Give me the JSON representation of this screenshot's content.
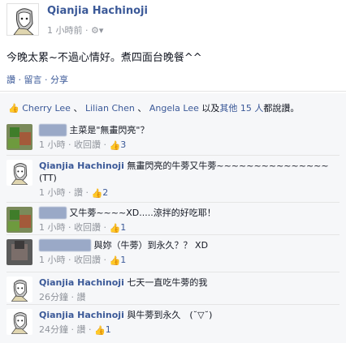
{
  "post": {
    "author": "Qianjia Hachinoji",
    "time": "1 小時前 · ",
    "text": "今晚太累~不過心情好。煮四面台晚餐^^",
    "actions": "讚 · 留言 · 分享"
  },
  "likes": {
    "names": [
      "Cherry Lee",
      "Lilian Chen",
      "Angela Lee"
    ],
    "sep1": " 、 ",
    "sep2": " 、 ",
    "tail_pre": "以及",
    "others": "其他 15 人",
    "tail_post": "都說讚。"
  },
  "comments": [
    {
      "author": "",
      "text": "主菜是\"無畫閃亮\"？",
      "meta": "1 小時 · 收回讚 · ",
      "likes": "3",
      "avatar": "green-blur"
    },
    {
      "author": "Qianjia Hachinoji",
      "text": "無畫閃亮的牛蒡又牛蒡~~~~~~~~~~~~~~~(TT)",
      "meta": "1 小時 · 讚 · ",
      "likes": "2",
      "avatar": "girl"
    },
    {
      "author": "",
      "text": "又牛蒡~~~~XD.....涼拌的好吃耶！",
      "meta": "1 小時 · 收回讚 · ",
      "likes": "1",
      "avatar": "green-blur"
    },
    {
      "author": "Aheeke Le",
      "text": "與妳（牛蒡）到永久？？ XD",
      "meta": "1 小時 · 收回讚 · ",
      "likes": "1",
      "avatar": "dark-blur"
    },
    {
      "author": "Qianjia Hachinoji",
      "text": "七天一直吃牛蒡的我",
      "meta": "26分鐘 · 讚",
      "likes": "",
      "avatar": "girl"
    },
    {
      "author": "Qianjia Hachinoji",
      "text": "與牛蒡到永久　(˘▽˘)",
      "meta": "24分鐘 · 讚 · ",
      "likes": "1",
      "avatar": "girl"
    }
  ],
  "colors": {
    "link": "#3b5998",
    "bg": "#f6f7f9",
    "muted": "#90949c"
  }
}
